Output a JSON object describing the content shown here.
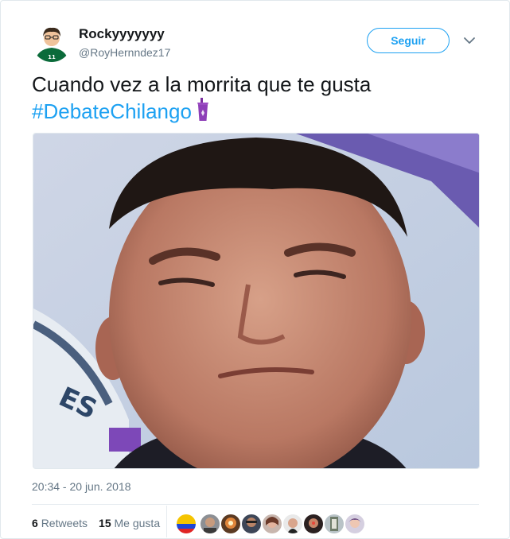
{
  "author": {
    "display_name": "Rockyyyyyyy",
    "handle": "@RoyHernndez17"
  },
  "follow_button": {
    "label": "Seguir"
  },
  "tweet": {
    "text": "Cuando vez a la morrita que te gusta",
    "hashtag": "#DebateChilango",
    "emoji_icon": "purple-cup-icon"
  },
  "timestamp": "20:34 - 20 jun. 2018",
  "stats": {
    "retweets_count": "6",
    "retweets_label": "Retweets",
    "likes_count": "15",
    "likes_label": "Me gusta"
  },
  "colors": {
    "accent": "#1da1f2",
    "text": "#14171a",
    "muted": "#657786",
    "border": "#e1e8ed"
  },
  "liker_avatars": [
    "liker-1",
    "liker-2",
    "liker-3",
    "liker-4",
    "liker-5",
    "liker-6",
    "liker-7",
    "liker-8",
    "liker-9"
  ]
}
